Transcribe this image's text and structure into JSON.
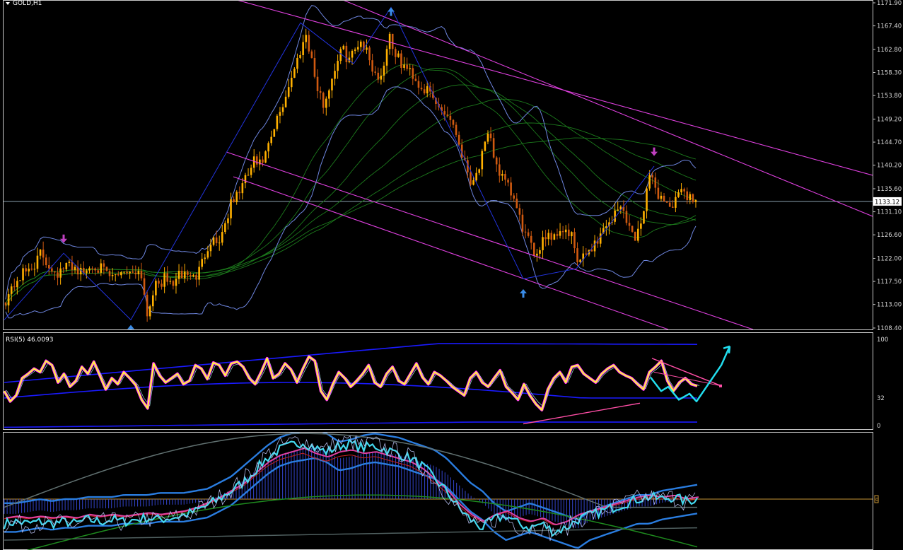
{
  "symbol_label": "GOLD,H1",
  "rsi_label": "RSI(5) 46.0093",
  "colors": {
    "background": "#000000",
    "frame": "#c8c8c8",
    "bull_candle": "#ffb000",
    "bear_candle": "#d05a10",
    "bollinger": "#6e86e0",
    "ma_ribbon": "#1c7a1c",
    "channel": "#e040e0",
    "zigzag": "#2233dd",
    "arrow_up": "#3a8ce8",
    "arrow_down": "#c040c0",
    "rsi_line": "#ffff33",
    "rsi_glow": "#ff33ff",
    "rsi_band": "#1a1aff",
    "forecast": "#22ddee",
    "trendline": "#ff4ea6",
    "price_line": "#a0b8c8",
    "level_line": "#c89636"
  },
  "chart_data": [
    {
      "type": "candlestick",
      "title": "GOLD,H1",
      "current_price": 1133.12,
      "price_axis_labels": [
        "1171.90",
        "1167.40",
        "1162.80",
        "1158.30",
        "1153.80",
        "1149.20",
        "1144.70",
        "1140.20",
        "1135.60",
        "1131.10",
        "1126.60",
        "1122.00",
        "1117.50",
        "1113.00",
        "1108.40"
      ],
      "price_axis_values": [
        1171.9,
        1167.4,
        1162.8,
        1158.3,
        1153.8,
        1149.2,
        1144.7,
        1140.2,
        1135.6,
        1131.1,
        1126.6,
        1122.0,
        1117.5,
        1113.0,
        1108.4
      ],
      "ylim": [
        1108.4,
        1171.9
      ],
      "close_path": [
        1114,
        1116,
        1118,
        1119,
        1120,
        1121,
        1123,
        1121,
        1120,
        1119,
        1120,
        1121,
        1120,
        1119,
        1120,
        1121,
        1120,
        1119,
        1118,
        1119,
        1120,
        1119,
        1120,
        1119,
        1111,
        1116,
        1117,
        1118,
        1117,
        1118,
        1119,
        1119,
        1118,
        1120,
        1124,
        1126,
        1125,
        1128,
        1132,
        1134,
        1136,
        1138,
        1141,
        1140,
        1142,
        1145,
        1149,
        1152,
        1156,
        1159,
        1163,
        1166,
        1160,
        1154,
        1152,
        1156,
        1160,
        1163,
        1161,
        1162,
        1165,
        1163,
        1160,
        1157,
        1159,
        1166,
        1162,
        1160,
        1159,
        1158,
        1156,
        1155,
        1154,
        1152,
        1151,
        1150,
        1148,
        1144,
        1140,
        1137,
        1139,
        1143,
        1146,
        1141,
        1138,
        1136,
        1134,
        1130,
        1127,
        1124,
        1123,
        1126,
        1127,
        1126,
        1128,
        1127,
        1126,
        1121,
        1122,
        1124,
        1125,
        1127,
        1129,
        1130,
        1132,
        1131,
        1127,
        1126,
        1131,
        1138,
        1136,
        1134,
        1133,
        1132,
        1134,
        1135,
        1134,
        1133.12
      ],
      "zigzag_prices": [
        1110,
        1123,
        1110,
        1168,
        1160,
        1171,
        1118,
        1120,
        1140
      ],
      "arrows": [
        {
          "dir": "down",
          "price": 1125
        },
        {
          "dir": "up",
          "price": 1109
        },
        {
          "dir": "up",
          "price": 1171
        },
        {
          "dir": "up",
          "price": 1116
        },
        {
          "dir": "down",
          "price": 1142
        }
      ]
    },
    {
      "type": "line",
      "title": "RSI(5) 46.0093",
      "axis_labels": [
        "100",
        "32",
        "0"
      ],
      "axis_values": [
        100,
        32,
        0
      ],
      "ylim": [
        0,
        100
      ],
      "current_value": 46.0093,
      "series": [
        {
          "values": [
            40,
            28,
            35,
            55,
            60,
            66,
            62,
            75,
            70,
            50,
            60,
            45,
            52,
            68,
            60,
            74,
            58,
            42,
            55,
            48,
            62,
            55,
            47,
            30,
            20,
            72,
            58,
            50,
            55,
            60,
            48,
            52,
            70,
            66,
            54,
            73,
            70,
            58,
            72,
            74,
            68,
            55,
            48,
            62,
            78,
            55,
            60,
            72,
            65,
            50,
            66,
            80,
            75,
            40,
            30,
            48,
            62,
            55,
            45,
            52,
            60,
            70,
            50,
            45,
            60,
            68,
            52,
            48,
            60,
            72,
            56,
            48,
            62,
            58,
            52,
            45,
            40,
            35,
            55,
            62,
            50,
            45,
            55,
            64,
            45,
            38,
            30,
            48,
            35,
            25,
            18,
            42,
            55,
            62,
            50,
            68,
            70,
            60,
            55,
            50,
            60,
            66,
            70,
            62,
            58,
            55,
            48,
            42,
            62,
            68,
            75,
            52,
            40,
            50,
            55,
            48,
            46
          ]
        }
      ],
      "forecast_values": [
        56,
        40,
        45,
        30,
        37,
        28,
        40,
        58,
        70,
        92
      ]
    },
    {
      "type": "line",
      "title": "",
      "axis_labels": [
        "0"
      ],
      "series": [
        {
          "values": [
            -8,
            -8,
            -7,
            -6,
            -7,
            -6,
            -6,
            -5,
            -5,
            -5,
            -4,
            -4,
            -4,
            -3,
            -3,
            -3,
            -2,
            -1,
            2,
            5,
            10,
            15,
            20,
            24,
            26,
            27,
            28,
            26,
            22,
            23,
            25,
            26,
            25,
            24,
            22,
            20,
            18,
            14,
            8,
            2,
            -2,
            -8,
            -12,
            -10,
            -8,
            -10,
            -12,
            -14,
            -16,
            -12,
            -10,
            -8,
            -6,
            -4,
            -4,
            -2,
            -1,
            0,
            1
          ]
        },
        {
          "values": [
            -12,
            -11,
            -12,
            -11,
            -12,
            -11,
            -12,
            -10,
            -11,
            -10,
            -11,
            -10,
            -9,
            -10,
            -9,
            -8,
            -6,
            -3,
            0,
            4,
            8,
            14,
            20,
            24,
            26,
            28,
            25,
            23,
            26,
            27,
            25,
            26,
            24,
            22,
            20,
            16,
            10,
            4,
            -4,
            -10,
            -14,
            -10,
            -8,
            -12,
            -14,
            -12,
            -16,
            -14,
            -10,
            -8,
            -6,
            -4,
            -2,
            0,
            1,
            0,
            1,
            -1,
            0
          ]
        }
      ]
    }
  ]
}
